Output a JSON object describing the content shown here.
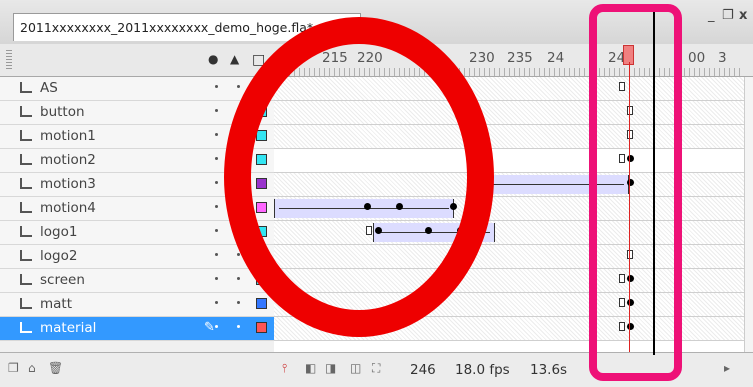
{
  "document": {
    "tab_title": "2011xxxxxxxx_2011xxxxxxxx_demo_hoge.fla*"
  },
  "window_controls": [
    "_",
    "❐",
    "x"
  ],
  "header": {
    "eye_icon": "eye-icon",
    "lock_icon": "lock-icon",
    "outline_icon": "outline-icon",
    "ruler_labels": [
      "215",
      "220",
      "230",
      "235",
      "24",
      "245",
      "00",
      "3"
    ]
  },
  "layers": [
    {
      "name": "AS",
      "color": null
    },
    {
      "name": "button",
      "color": "#33e5f2"
    },
    {
      "name": "motion1",
      "color": "#33e5f2"
    },
    {
      "name": "motion2",
      "color": "#33e5f2"
    },
    {
      "name": "motion3",
      "color": "#9933cc"
    },
    {
      "name": "motion4",
      "color": "#ff66ff"
    },
    {
      "name": "logo1",
      "color": "#33e5f2"
    },
    {
      "name": "logo2",
      "color": "#777777"
    },
    {
      "name": "screen",
      "color": "#33e5f2"
    },
    {
      "name": "matt",
      "color": "#3377ff"
    },
    {
      "name": "material",
      "color": "#ff5555",
      "selected": true
    }
  ],
  "status": {
    "frame": "246",
    "fps": "18.0 fps",
    "time": "13.6s"
  },
  "annotation": {
    "circle_color": "#ee0000",
    "box_color": "#ee1177"
  }
}
